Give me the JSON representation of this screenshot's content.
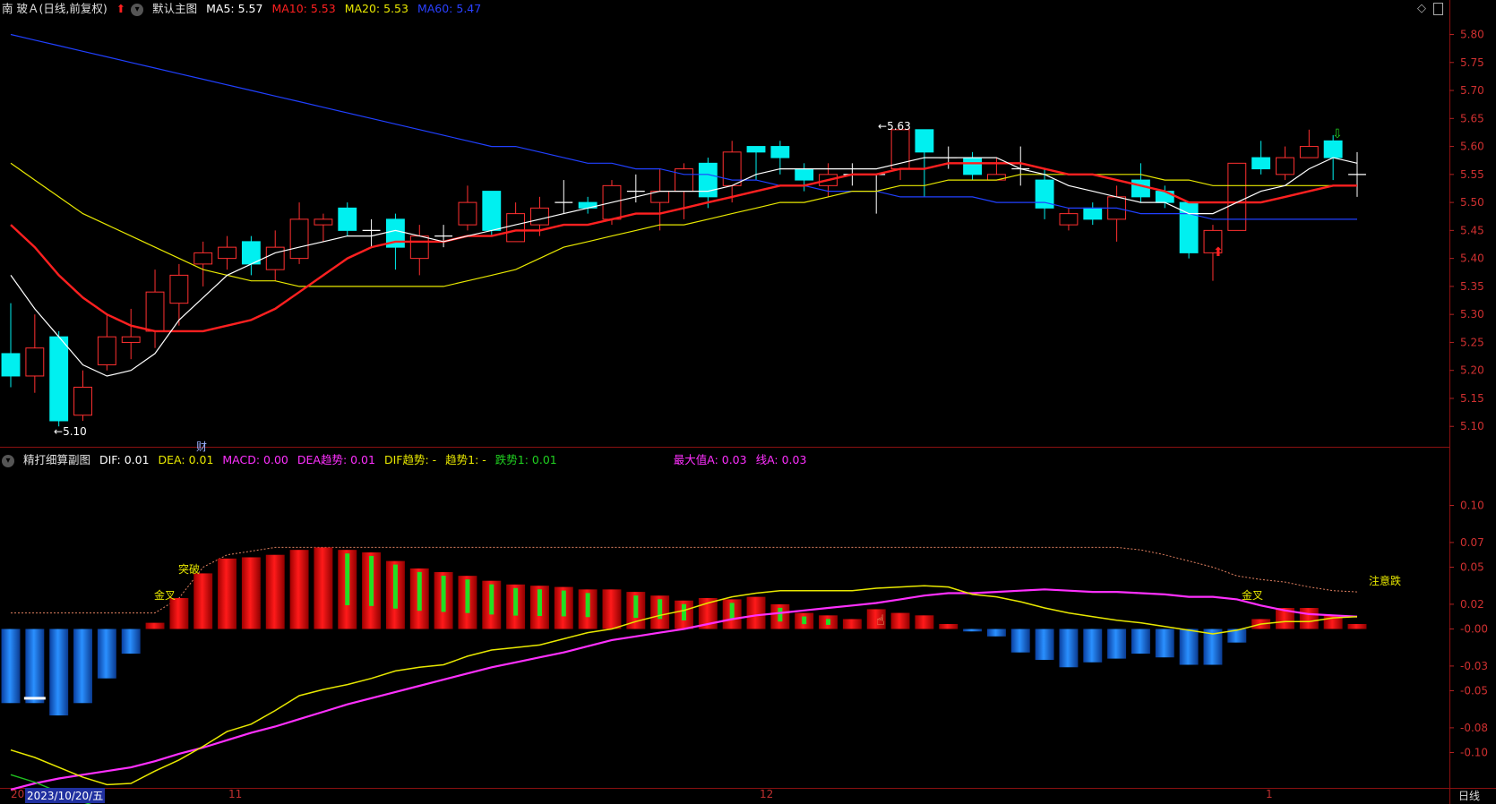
{
  "main_header": {
    "stock_name": "南 玻Ａ(日线,前复权)",
    "template": "默认主图",
    "ma5": "MA5: 5.57",
    "ma10": "MA10: 5.53",
    "ma20": "MA20: 5.53",
    "ma60": "MA60: 5.47",
    "color_ma5": "#ffffff",
    "color_ma10": "#ff2020",
    "color_ma20": "#e8e800",
    "color_ma60": "#2040ff"
  },
  "sub_header": {
    "title": "精打细算副图",
    "dif": "DIF: 0.01",
    "dea": "DEA: 0.01",
    "macd": "MACD: 0.00",
    "dea_trend": "DEA趋势: 0.01",
    "dif_trend": "DIF趋势: -",
    "trend1": "趋势1: -",
    "fall1": "跌势1: 0.01",
    "max_a": "最大值A: 0.03",
    "line_a": "线A: 0.03"
  },
  "main_axis": [
    "5.80",
    "5.75",
    "5.70",
    "5.65",
    "5.60",
    "5.55",
    "5.50",
    "5.45",
    "5.40",
    "5.35",
    "5.30",
    "5.25",
    "5.20",
    "5.15",
    "5.10"
  ],
  "sub_axis": [
    "0.10",
    "0.07",
    "0.05",
    "0.02",
    "-0.00",
    "-0.03",
    "-0.05",
    "-0.08",
    "-0.10"
  ],
  "x_axis": {
    "left": "20",
    "date": "2023/10/20/五",
    "m11": "11",
    "m12": "12",
    "m1": "1",
    "period": "日线"
  },
  "annotations": {
    "low_price": "5.10",
    "high_price": "5.63",
    "cai": "财",
    "tupo": "突破",
    "jincha1": "金叉",
    "jincha2": "金叉",
    "zhuyi": "注意跌"
  },
  "chart_data": {
    "type": "candlestick",
    "main_ylim": [
      5.07,
      5.82
    ],
    "candles": [
      [
        5.23,
        5.19,
        5.32,
        5.17
      ],
      [
        5.19,
        5.24,
        5.3,
        5.16
      ],
      [
        5.26,
        5.11,
        5.27,
        5.1
      ],
      [
        5.12,
        5.17,
        5.2,
        5.11
      ],
      [
        5.21,
        5.26,
        5.3,
        5.2
      ],
      [
        5.25,
        5.26,
        5.31,
        5.22
      ],
      [
        5.27,
        5.34,
        5.38,
        5.24
      ],
      [
        5.32,
        5.37,
        5.39,
        5.28
      ],
      [
        5.39,
        5.41,
        5.43,
        5.35
      ],
      [
        5.4,
        5.42,
        5.44,
        5.38
      ],
      [
        5.43,
        5.39,
        5.44,
        5.37
      ],
      [
        5.38,
        5.42,
        5.45,
        5.36
      ],
      [
        5.4,
        5.47,
        5.5,
        5.39
      ],
      [
        5.46,
        5.47,
        5.48,
        5.43
      ],
      [
        5.49,
        5.45,
        5.5,
        5.44
      ],
      [
        5.45,
        5.45,
        5.47,
        5.42
      ],
      [
        5.47,
        5.42,
        5.48,
        5.38
      ],
      [
        5.4,
        5.44,
        5.46,
        5.37
      ],
      [
        5.44,
        5.44,
        5.46,
        5.42
      ],
      [
        5.46,
        5.5,
        5.53,
        5.45
      ],
      [
        5.52,
        5.45,
        5.52,
        5.44
      ],
      [
        5.43,
        5.48,
        5.5,
        5.43
      ],
      [
        5.46,
        5.49,
        5.51,
        5.44
      ],
      [
        5.5,
        5.5,
        5.54,
        5.48
      ],
      [
        5.5,
        5.49,
        5.51,
        5.48
      ],
      [
        5.47,
        5.53,
        5.54,
        5.46
      ],
      [
        5.52,
        5.52,
        5.55,
        5.5
      ],
      [
        5.5,
        5.52,
        5.56,
        5.45
      ],
      [
        5.52,
        5.56,
        5.57,
        5.47
      ],
      [
        5.57,
        5.51,
        5.58,
        5.49
      ],
      [
        5.53,
        5.59,
        5.61,
        5.5
      ],
      [
        5.6,
        5.59,
        5.6,
        5.54
      ],
      [
        5.6,
        5.58,
        5.61,
        5.55
      ],
      [
        5.56,
        5.54,
        5.57,
        5.52
      ],
      [
        5.53,
        5.55,
        5.57,
        5.51
      ],
      [
        5.55,
        5.55,
        5.57,
        5.53
      ],
      [
        5.55,
        5.55,
        5.55,
        5.48
      ],
      [
        5.56,
        5.63,
        5.63,
        5.54
      ],
      [
        5.63,
        5.59,
        5.63,
        5.51
      ],
      [
        5.58,
        5.58,
        5.6,
        5.56
      ],
      [
        5.58,
        5.55,
        5.59,
        5.54
      ],
      [
        5.54,
        5.55,
        5.58,
        5.54
      ],
      [
        5.56,
        5.56,
        5.6,
        5.53
      ],
      [
        5.54,
        5.49,
        5.56,
        5.47
      ],
      [
        5.46,
        5.48,
        5.49,
        5.45
      ],
      [
        5.49,
        5.47,
        5.5,
        5.46
      ],
      [
        5.47,
        5.51,
        5.53,
        5.43
      ],
      [
        5.54,
        5.51,
        5.57,
        5.5
      ],
      [
        5.52,
        5.5,
        5.53,
        5.49
      ],
      [
        5.5,
        5.41,
        5.5,
        5.4
      ],
      [
        5.41,
        5.45,
        5.46,
        5.36
      ],
      [
        5.45,
        5.57,
        5.57,
        5.45
      ],
      [
        5.58,
        5.56,
        5.61,
        5.55
      ],
      [
        5.55,
        5.58,
        5.6,
        5.54
      ],
      [
        5.58,
        5.6,
        5.63,
        5.58
      ],
      [
        5.61,
        5.58,
        5.62,
        5.54
      ],
      [
        5.55,
        5.55,
        5.59,
        5.51
      ]
    ],
    "ma5": [
      5.37,
      5.31,
      5.26,
      5.21,
      5.19,
      5.2,
      5.23,
      5.29,
      5.33,
      5.37,
      5.39,
      5.41,
      5.42,
      5.43,
      5.44,
      5.44,
      5.45,
      5.44,
      5.43,
      5.44,
      5.45,
      5.46,
      5.47,
      5.48,
      5.49,
      5.5,
      5.51,
      5.52,
      5.52,
      5.52,
      5.53,
      5.55,
      5.56,
      5.56,
      5.56,
      5.56,
      5.56,
      5.57,
      5.58,
      5.58,
      5.58,
      5.58,
      5.56,
      5.55,
      5.53,
      5.52,
      5.51,
      5.5,
      5.5,
      5.48,
      5.48,
      5.5,
      5.52,
      5.53,
      5.56,
      5.58,
      5.57
    ],
    "ma10": [
      5.46,
      5.42,
      5.37,
      5.33,
      5.3,
      5.28,
      5.27,
      5.27,
      5.27,
      5.28,
      5.29,
      5.31,
      5.34,
      5.37,
      5.4,
      5.42,
      5.43,
      5.43,
      5.43,
      5.44,
      5.44,
      5.45,
      5.45,
      5.46,
      5.46,
      5.47,
      5.48,
      5.48,
      5.49,
      5.5,
      5.51,
      5.52,
      5.53,
      5.53,
      5.54,
      5.55,
      5.55,
      5.56,
      5.56,
      5.57,
      5.57,
      5.57,
      5.57,
      5.56,
      5.55,
      5.55,
      5.54,
      5.53,
      5.52,
      5.5,
      5.5,
      5.5,
      5.5,
      5.51,
      5.52,
      5.53,
      5.53
    ],
    "ma20": [
      5.57,
      5.54,
      5.51,
      5.48,
      5.46,
      5.44,
      5.42,
      5.4,
      5.38,
      5.37,
      5.36,
      5.36,
      5.35,
      5.35,
      5.35,
      5.35,
      5.35,
      5.35,
      5.35,
      5.36,
      5.37,
      5.38,
      5.4,
      5.42,
      5.43,
      5.44,
      5.45,
      5.46,
      5.46,
      5.47,
      5.48,
      5.49,
      5.5,
      5.5,
      5.51,
      5.52,
      5.52,
      5.53,
      5.53,
      5.54,
      5.54,
      5.54,
      5.55,
      5.55,
      5.55,
      5.55,
      5.55,
      5.55,
      5.54,
      5.54,
      5.53,
      5.53,
      5.53,
      5.53,
      5.53,
      5.53,
      5.53
    ],
    "ma60": [
      5.8,
      5.79,
      5.78,
      5.77,
      5.76,
      5.75,
      5.74,
      5.73,
      5.72,
      5.71,
      5.7,
      5.69,
      5.68,
      5.67,
      5.66,
      5.65,
      5.64,
      5.63,
      5.62,
      5.61,
      5.6,
      5.6,
      5.59,
      5.58,
      5.57,
      5.57,
      5.56,
      5.56,
      5.55,
      5.55,
      5.54,
      5.54,
      5.53,
      5.53,
      5.52,
      5.52,
      5.52,
      5.51,
      5.51,
      5.51,
      5.51,
      5.5,
      5.5,
      5.5,
      5.49,
      5.49,
      5.49,
      5.48,
      5.48,
      5.48,
      5.47,
      5.47,
      5.47,
      5.47,
      5.47,
      5.47,
      5.47
    ],
    "sub_ylim": [
      -0.125,
      0.125
    ],
    "macd_hist": [
      -0.06,
      -0.06,
      -0.07,
      -0.06,
      -0.04,
      -0.02,
      0.005,
      0.025,
      0.045,
      0.057,
      0.058,
      0.06,
      0.064,
      0.066,
      0.064,
      0.062,
      0.055,
      0.049,
      0.046,
      0.043,
      0.039,
      0.036,
      0.035,
      0.034,
      0.032,
      0.032,
      0.03,
      0.027,
      0.023,
      0.025,
      0.024,
      0.026,
      0.02,
      0.013,
      0.011,
      0.008,
      0.016,
      0.013,
      0.011,
      0.004,
      -0.002,
      -0.006,
      -0.019,
      -0.025,
      -0.031,
      -0.027,
      -0.024,
      -0.02,
      -0.023,
      -0.029,
      -0.029,
      -0.011,
      0.008,
      0.017,
      0.017,
      0.011,
      0.004
    ],
    "dif": [
      -0.098,
      -0.104,
      -0.112,
      -0.12,
      -0.126,
      -0.125,
      -0.115,
      -0.106,
      -0.095,
      -0.083,
      -0.077,
      -0.066,
      -0.054,
      -0.049,
      -0.045,
      -0.04,
      -0.034,
      -0.031,
      -0.029,
      -0.022,
      -0.017,
      -0.015,
      -0.013,
      -0.008,
      -0.003,
      0.0,
      0.006,
      0.011,
      0.015,
      0.021,
      0.026,
      0.029,
      0.031,
      0.031,
      0.031,
      0.031,
      0.033,
      0.034,
      0.035,
      0.034,
      0.028,
      0.026,
      0.022,
      0.017,
      0.013,
      0.01,
      0.007,
      0.005,
      0.002,
      -0.001,
      -0.004,
      -0.001,
      0.004,
      0.006,
      0.006,
      0.009,
      0.01
    ],
    "dea": [
      -0.13,
      -0.125,
      -0.121,
      -0.118,
      -0.115,
      -0.112,
      -0.107,
      -0.101,
      -0.096,
      -0.09,
      -0.084,
      -0.079,
      -0.073,
      -0.067,
      -0.061,
      -0.056,
      -0.051,
      -0.046,
      -0.041,
      -0.036,
      -0.031,
      -0.027,
      -0.023,
      -0.019,
      -0.014,
      -0.009,
      -0.006,
      -0.003,
      0.0,
      0.004,
      0.008,
      0.011,
      0.013,
      0.015,
      0.017,
      0.019,
      0.021,
      0.024,
      0.027,
      0.029,
      0.029,
      0.03,
      0.031,
      0.032,
      0.031,
      0.03,
      0.03,
      0.029,
      0.028,
      0.026,
      0.026,
      0.024,
      0.019,
      0.015,
      0.012,
      0.011,
      0.01
    ],
    "line_a": [
      0.013,
      0.013,
      0.013,
      0.013,
      0.013,
      0.013,
      0.013,
      0.025,
      0.05,
      0.06,
      0.063,
      0.066,
      0.066,
      0.066,
      0.066,
      0.066,
      0.066,
      0.066,
      0.066,
      0.066,
      0.066,
      0.066,
      0.066,
      0.066,
      0.066,
      0.066,
      0.066,
      0.066,
      0.066,
      0.066,
      0.066,
      0.066,
      0.066,
      0.066,
      0.066,
      0.066,
      0.066,
      0.066,
      0.066,
      0.066,
      0.066,
      0.066,
      0.066,
      0.066,
      0.066,
      0.066,
      0.066,
      0.064,
      0.06,
      0.055,
      0.05,
      0.043,
      0.04,
      0.038,
      0.034,
      0.031,
      0.03
    ]
  }
}
